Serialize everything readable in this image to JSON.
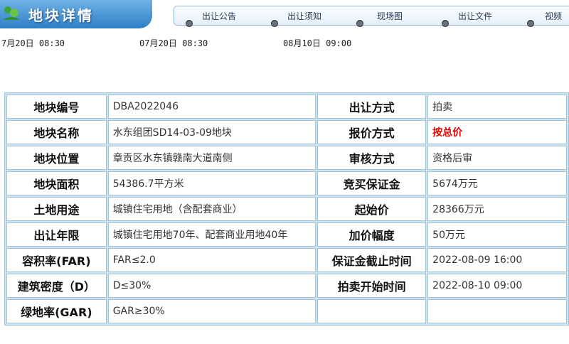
{
  "header": {
    "title": "地块详情"
  },
  "nav": [
    "出让公告",
    "出让须知",
    "现场图",
    "出让文件",
    "视频"
  ],
  "timeline": [
    "7月20日 08:30",
    "07月20日 08:30",
    "08月10日 09:00"
  ],
  "rows": [
    [
      "地块编号",
      "DBA2022046",
      "出让方式",
      "拍卖"
    ],
    [
      "地块名称",
      "水东组团SD14-03-09地块",
      "报价方式",
      "按总价"
    ],
    [
      "地块位置",
      "章贡区水东镇赣南大道南侧",
      "审核方式",
      "资格后审"
    ],
    [
      "地块面积",
      "54386.7平方米",
      "竞买保证金",
      "5674万元"
    ],
    [
      "土地用途",
      "城镇住宅用地（含配套商业）",
      "起始价",
      "28366万元"
    ],
    [
      "出让年限",
      "城镇住宅用地70年、配套商业用地40年",
      "加价幅度",
      "50万元"
    ],
    [
      "容积率(FAR)",
      "FAR≤2.0",
      "保证金截止时间",
      "2022-08-09 16:00"
    ],
    [
      "建筑密度（D）",
      "D≤30%",
      "拍卖开始时间",
      "2022-08-10 09:00"
    ],
    [
      "绿地率(GAR)",
      "GAR≥30%"
    ]
  ],
  "colors": {
    "accent": "#2f7fc6",
    "highlight": "#e00000"
  }
}
